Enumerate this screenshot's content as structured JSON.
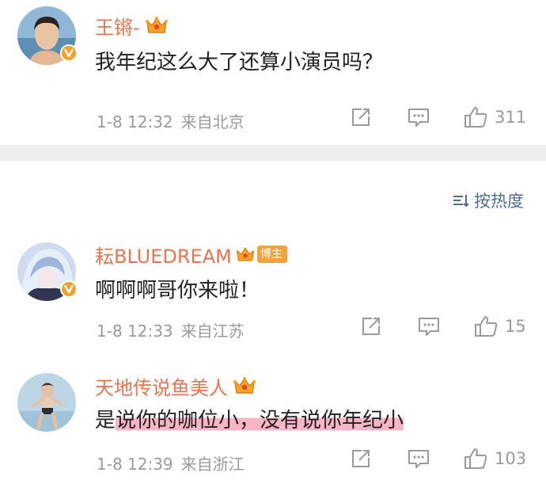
{
  "comments": [
    {
      "username": "王锵-",
      "text": "我年纪这么大了还算小演员吗？",
      "date": "1-8 12:32",
      "source": "来自北京",
      "likes": "311"
    },
    {
      "username": "耘BLUEDREAM",
      "tag": "博主",
      "text": "啊啊啊哥你来啦！",
      "date": "1-8 12:33",
      "source": "来自江苏",
      "likes": "15"
    },
    {
      "username": "天地传说鱼美人",
      "text_prefix": "是",
      "text_highlight": "说你的咖位小，没有说你年纪小",
      "date": "1-8 12:39",
      "source": "来自浙江",
      "likes": "103"
    }
  ],
  "sort_label": "按热度",
  "colors": {
    "username": "#eb7350",
    "meta": "#9a9a9a",
    "sort": "#4d6f93",
    "highlight": "#f57896",
    "badge": "#f0a229"
  }
}
